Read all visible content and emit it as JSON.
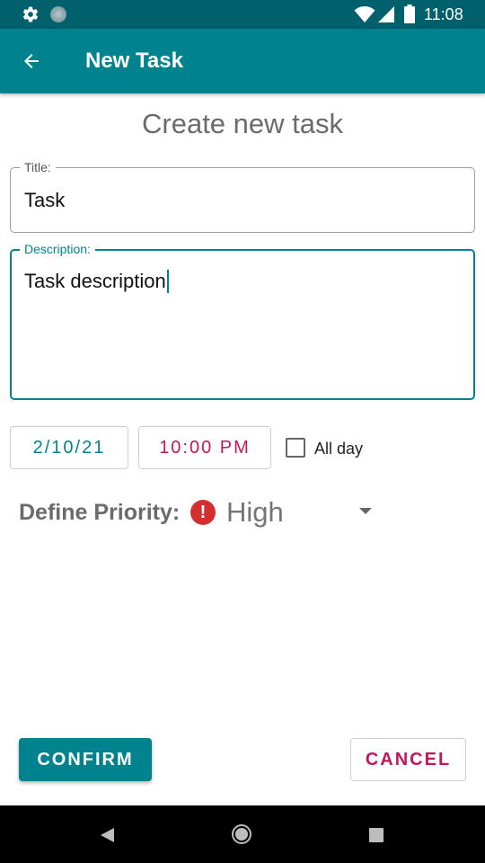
{
  "status_bar": {
    "time": "11:08",
    "icons": [
      "gear-icon",
      "sync-dot-icon",
      "wifi-icon",
      "signal-icon",
      "battery-icon"
    ]
  },
  "app_bar": {
    "title": "New Task",
    "back_icon": "arrow-back-icon"
  },
  "form": {
    "heading": "Create new task",
    "title_field": {
      "label": "Title:",
      "value": "Task"
    },
    "description_field": {
      "label": "Description:",
      "value": "Task description"
    },
    "date": "2/10/21",
    "time": "10:00 PM",
    "all_day": {
      "label": "All day",
      "checked": false
    },
    "priority": {
      "label": "Define Priority:",
      "value": "High",
      "icon": "alert-circle-icon",
      "icon_glyph": "!"
    }
  },
  "actions": {
    "confirm": "CONFIRM",
    "cancel": "CANCEL"
  },
  "colors": {
    "primary": "#00838f",
    "primary_dark": "#00606b",
    "accent": "#c2185b",
    "priority_high": "#d32f2f"
  },
  "nav_bar": {
    "icons": [
      "nav-back-icon",
      "nav-home-icon",
      "nav-recents-icon"
    ]
  }
}
